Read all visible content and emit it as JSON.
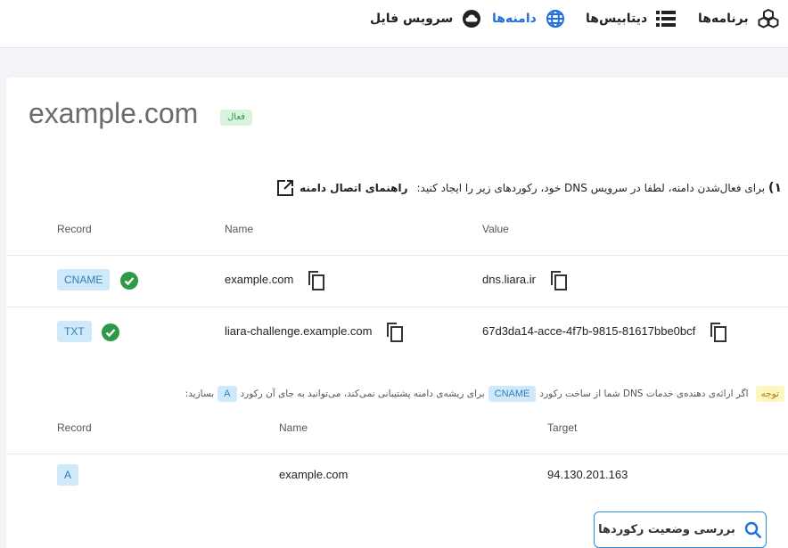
{
  "nav": {
    "items": [
      {
        "label": "برنامه‌ها",
        "icon": "cubes-icon"
      },
      {
        "label": "دیتابیس‌ها",
        "icon": "database-icon"
      },
      {
        "label": "دامنه‌ها",
        "icon": "globe-icon"
      },
      {
        "label": "سرویس فایل",
        "icon": "cloud-icon"
      }
    ]
  },
  "domain": {
    "name": "example.com",
    "status": "فعال"
  },
  "instruction": {
    "step": "۱)",
    "text": "برای فعال‌شدن دامنه، لطفا در سرویس DNS خود، رکوردهای زیر را ایجاد کنید:",
    "guide_link": "راهنمای اتصال دامنه"
  },
  "table1": {
    "headers": {
      "record": "Record",
      "name": "Name",
      "value": "Value"
    },
    "rows": [
      {
        "type": "CNAME",
        "name": "example.com",
        "value": "dns.liara.ir"
      },
      {
        "type": "TXT",
        "name": "liara-challenge.example.com",
        "value": "67d3da14-acce-4f7b-9815-81617bbe0bcf"
      }
    ]
  },
  "note": {
    "tag": "توجه",
    "part1": "اگر ارائه‌ی دهنده‌ی خدمات DNS شما از ساخت رکورد",
    "chip1": "CNAME",
    "part2": "برای ریشه‌ی دامنه پشتیبانی نمی‌کند، می‌توانید به جای آن رکورد",
    "chip2": "A",
    "part3": "بسازید:"
  },
  "table2": {
    "headers": {
      "record": "Record",
      "name": "Name",
      "target": "Target"
    },
    "rows": [
      {
        "type": "A",
        "name": "example.com",
        "target": "94.130.201.163"
      }
    ]
  },
  "check_button": {
    "label": "بررسی وضعیت رکوردها",
    "icon": "search-icon"
  },
  "colors": {
    "accent": "#1e6fe0",
    "badge_bg": "#cfe8fa",
    "badge_text": "#2f7fb8",
    "success": "#2e9a47",
    "note_bg": "#fcf6bf"
  }
}
